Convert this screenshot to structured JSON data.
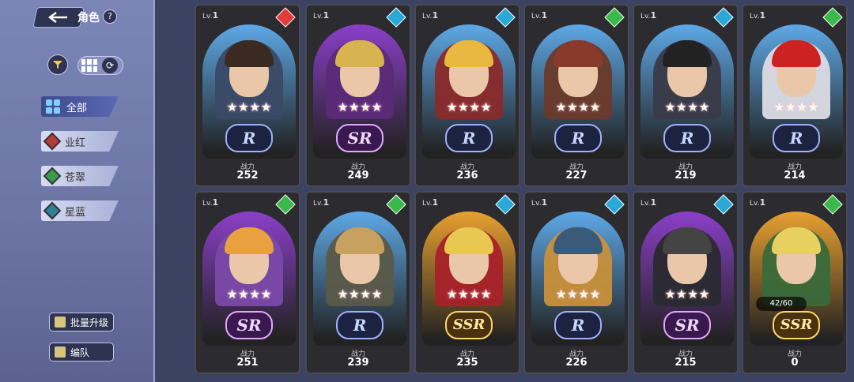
{
  "header": {
    "title": "角色",
    "help": "?"
  },
  "categories": [
    {
      "label": "全部",
      "color": "#7fd0ff"
    },
    {
      "label": "业红",
      "color": "#b73a3a"
    },
    {
      "label": "苍翠",
      "color": "#3a9a4a"
    },
    {
      "label": "星蓝",
      "color": "#2f7f95"
    }
  ],
  "actions": {
    "batch_upgrade": "批量升级",
    "formation": "编队"
  },
  "power_label": "战力",
  "level_label": "Lv.",
  "cards": [
    {
      "level": "1",
      "rarity": "R",
      "stars": "★★★★",
      "power": "252",
      "element": "#e23b3b",
      "arch": "#5ea8e6",
      "portrait": "#3a4a66",
      "hair": "#3a2a22"
    },
    {
      "level": "1",
      "rarity": "SR",
      "stars": "★★★★",
      "power": "249",
      "element": "#2aa8d8",
      "arch": "#8b3fc8",
      "portrait": "#5b2a78",
      "hair": "#d8b450"
    },
    {
      "level": "1",
      "rarity": "R",
      "stars": "★★★★",
      "power": "236",
      "element": "#2aa8d8",
      "arch": "#5ea8e6",
      "portrait": "#8a2a2a",
      "hair": "#e8b840"
    },
    {
      "level": "1",
      "rarity": "R",
      "stars": "★★★★",
      "power": "227",
      "element": "#3ab84a",
      "arch": "#5ea8e6",
      "portrait": "#6a3a2a",
      "hair": "#8a3a2a"
    },
    {
      "level": "1",
      "rarity": "R",
      "stars": "★★★★",
      "power": "219",
      "element": "#2aa8d8",
      "arch": "#5ea8e6",
      "portrait": "#3a3a48",
      "hair": "#222"
    },
    {
      "level": "1",
      "rarity": "R",
      "stars": "★★★★",
      "power": "214",
      "element": "#3ab84a",
      "arch": "#5ea8e6",
      "portrait": "#dcdce4",
      "hair": "#c22"
    },
    {
      "level": "1",
      "rarity": "SR",
      "stars": "★★★★",
      "power": "251",
      "element": "#3ab84a",
      "arch": "#8b3fc8",
      "portrait": "#7a4aa8",
      "hair": "#e8a040"
    },
    {
      "level": "1",
      "rarity": "R",
      "stars": "★★★★",
      "power": "239",
      "element": "#3ab84a",
      "arch": "#5ea8e6",
      "portrait": "#5a5a48",
      "hair": "#c8a060"
    },
    {
      "level": "1",
      "rarity": "SSR",
      "stars": "★★★★",
      "power": "235",
      "element": "#2aa8d8",
      "arch": "#e8a030",
      "portrait": "#a8222a",
      "hair": "#e8c850"
    },
    {
      "level": "1",
      "rarity": "R",
      "stars": "★★★★",
      "power": "226",
      "element": "#2aa8d8",
      "arch": "#5ea8e6",
      "portrait": "#c8903a",
      "hair": "#3a5a7a"
    },
    {
      "level": "1",
      "rarity": "SR",
      "stars": "★★★★",
      "power": "215",
      "element": "#2aa8d8",
      "arch": "#8b3fc8",
      "portrait": "#2a2a30",
      "hair": "#444"
    },
    {
      "level": "1",
      "rarity": "SSR",
      "stars": "",
      "power": "0",
      "element": "#3ab84a",
      "arch": "#e8a030",
      "portrait": "#3a6a3a",
      "hair": "#e8d060",
      "shards": "42/60"
    }
  ]
}
